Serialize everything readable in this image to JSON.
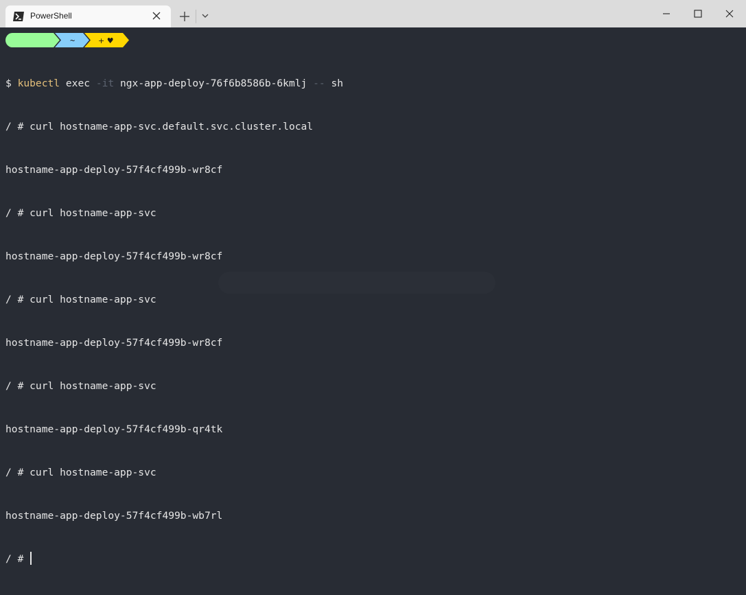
{
  "window": {
    "tab_title": "PowerShell",
    "icons": {
      "tab": "powershell-icon",
      "close_tab": "close-icon",
      "new_tab": "plus-icon",
      "dropdown": "chevron-down-icon",
      "minimize": "minimize-icon",
      "maximize": "maximize-icon",
      "close": "close-icon"
    }
  },
  "prompt": {
    "segments": [
      {
        "text": "",
        "color": "#98fb98"
      },
      {
        "text": "~",
        "color": "#87cefa"
      },
      {
        "text": "+ ♥",
        "color": "#ffd700"
      }
    ]
  },
  "terminal": {
    "lines": [
      {
        "prefix": "$ ",
        "cmd": "kubectl",
        "rest1": " exec ",
        "flag": "-it",
        "rest2": " ngx-app-deploy-76f6b8586b-6kmlj ",
        "flag2": "--",
        "rest3": " sh"
      },
      {
        "text": "/ # curl hostname-app-svc.default.svc.cluster.local"
      },
      {
        "text": "hostname-app-deploy-57f4cf499b-wr8cf"
      },
      {
        "text": "/ # curl hostname-app-svc"
      },
      {
        "text": "hostname-app-deploy-57f4cf499b-wr8cf"
      },
      {
        "text": "/ # curl hostname-app-svc"
      },
      {
        "text": "hostname-app-deploy-57f4cf499b-wr8cf"
      },
      {
        "text": "/ # curl hostname-app-svc"
      },
      {
        "text": "hostname-app-deploy-57f4cf499b-qr4tk"
      },
      {
        "text": "/ # curl hostname-app-svc"
      },
      {
        "text": "hostname-app-deploy-57f4cf499b-wb7rl"
      },
      {
        "text": "/ # "
      }
    ]
  },
  "colors": {
    "background": "#282c34",
    "foreground": "#e6e6e6",
    "command": "#e5c07b",
    "flag": "#5c6370"
  }
}
